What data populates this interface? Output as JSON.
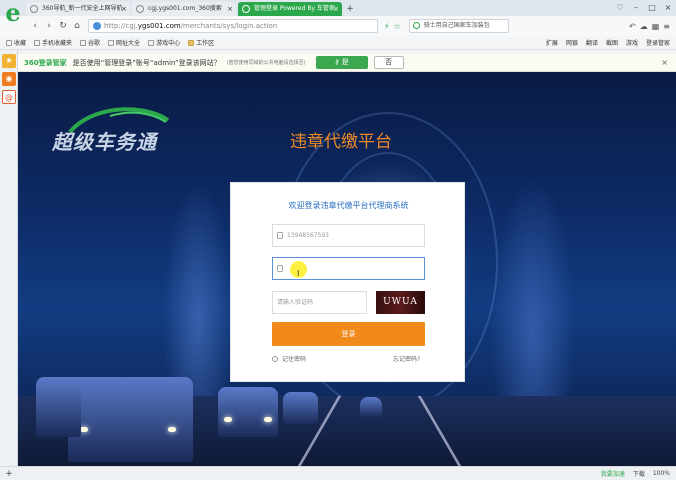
{
  "browser": {
    "tabs": [
      {
        "label": "360导航_新一代安全上网导航",
        "active": false
      },
      {
        "label": "cgj.ygs001.com_360搜索",
        "active": false
      },
      {
        "label": "管理登录 Powered By 车管家",
        "active": true
      }
    ],
    "new_tab": "+",
    "address": {
      "prefix": "http://cgj.",
      "domain": "ygs001.com",
      "path": "/merchants/sys/login.action"
    },
    "search_text": "骑士用自己国家车加装包",
    "bookmarks": [
      {
        "label": "收藏",
        "folder": false
      },
      {
        "label": "手机收藏夹",
        "folder": false
      },
      {
        "label": "谷歌",
        "folder": false
      },
      {
        "label": "网址大全",
        "folder": false
      },
      {
        "label": "游戏中心",
        "folder": false
      },
      {
        "label": "工作区",
        "folder": true
      }
    ],
    "bookmarks_right": [
      "扩展",
      "网银",
      "翻译",
      "截图",
      "游戏",
      "登录管家"
    ]
  },
  "notification": {
    "brand": "360登录管家",
    "message": "是否使用“管理登录”账号“admin”登录该网站？",
    "hint": "(若您使用同域的公共电脑请选择否)",
    "yes_label": "是",
    "no_label": "否",
    "close": "×"
  },
  "site": {
    "logo_text": "超级车务通",
    "title": "违章代缴平台"
  },
  "login": {
    "heading": "欢迎登录违章代缴平台代理商系统",
    "username_placeholder": "13948567593",
    "password_placeholder": "",
    "cursor": "I",
    "captcha_placeholder": "请输入验证码",
    "captcha_text": "UWUA",
    "submit_label": "登录",
    "remember_label": "记住密码",
    "forgot_label": "忘记密码?"
  },
  "statusbar": {
    "items": [
      "我要加速",
      "下载",
      "100%"
    ]
  },
  "colors": {
    "accent_green": "#2ca84c",
    "title_orange": "#f08a24",
    "login_button": "#f28a1b",
    "heading_blue": "#2a6fc2"
  }
}
